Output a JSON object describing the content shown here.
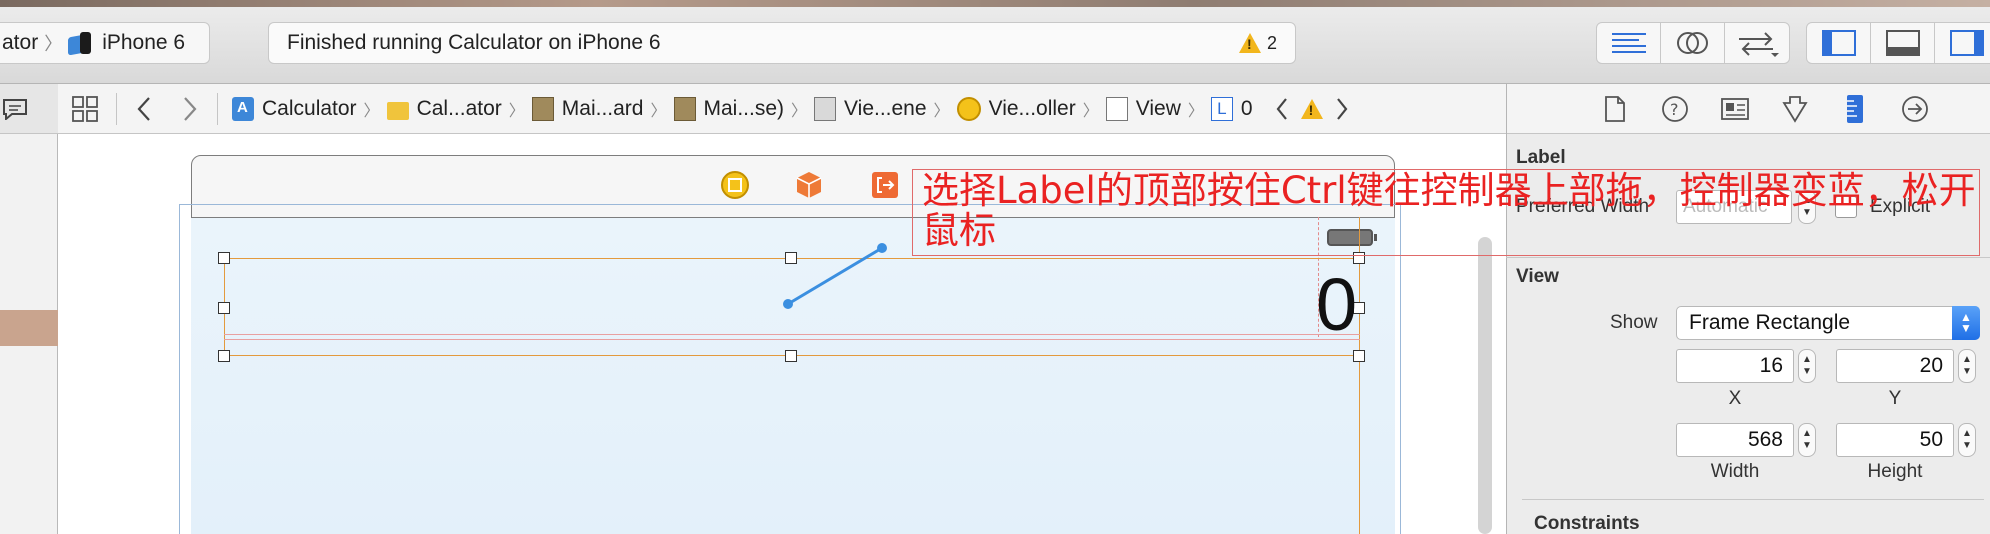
{
  "toolbar": {
    "scheme": {
      "target": "ator",
      "device": "iPhone 6"
    },
    "status": {
      "message": "Finished running Calculator on iPhone 6",
      "warning_count": "2"
    }
  },
  "jumpbar": {
    "crumbs": [
      {
        "label": "Calculator",
        "icon": "project-icon"
      },
      {
        "label": "Cal...ator",
        "icon": "folder-icon"
      },
      {
        "label": "Mai...ard",
        "icon": "storyboard-icon"
      },
      {
        "label": "Mai...se)",
        "icon": "storyboard-icon"
      },
      {
        "label": "Vie...ene",
        "icon": "scene-icon"
      },
      {
        "label": "Vie...oller",
        "icon": "view-controller-icon"
      },
      {
        "label": "View",
        "icon": "view-icon"
      },
      {
        "label": "0",
        "icon": "label-icon",
        "icon_text": "L"
      }
    ]
  },
  "canvas": {
    "label_text": "0",
    "annotation": "选择Label的顶部按住Ctrl键往控制器上部拖，控制器变蓝，松开鼠标"
  },
  "inspector": {
    "label_section": {
      "title": "Label",
      "preferred_width_label": "Preferred Width",
      "preferred_width_placeholder": "Automatic",
      "explicit_label": "Explicit"
    },
    "view_section": {
      "title": "View",
      "show_label": "Show",
      "show_value": "Frame Rectangle",
      "x": "16",
      "x_caption": "X",
      "y": "20",
      "y_caption": "Y",
      "width": "568",
      "width_caption": "Width",
      "height": "50",
      "height_caption": "Height"
    },
    "constraints_title": "Constraints"
  },
  "colors": {
    "accent_blue": "#2f6fd8",
    "selection_orange": "#e39a3d",
    "annotation_red": "#ea2222",
    "warning_yellow": "#f2b61c"
  }
}
